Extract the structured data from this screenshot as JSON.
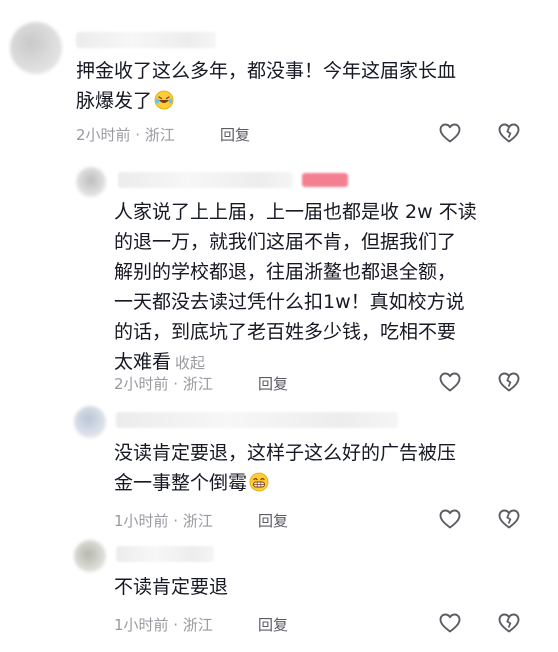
{
  "comments": [
    {
      "text_lines": [
        "押金收了这么多年，都没事！今年这届家长血",
        "脉爆发了"
      ],
      "emoji": "laughing-tears-emoji",
      "time_location": "2小时前 · 浙江",
      "reply_label": "回复"
    },
    {
      "text_lines": [
        "人家说了上上届，上一届也都是收 2w 不读",
        "的退一万，就我们这届不肯，但据我们了",
        "解别的学校都退，往届浙鳌也都退全额，",
        "一天都没去读过凭什么扣1w！真如校方说",
        "的话，到底坑了老百姓多少钱，吃相不要",
        "太难看"
      ],
      "fold_label": "收起",
      "time_location": "2小时前 · 浙江",
      "reply_label": "回复"
    },
    {
      "text_lines": [
        "没读肯定要退，这样子这么好的广告被压",
        "金一事整个倒霉"
      ],
      "emoji": "grinning-emoji",
      "time_location": "1小时前 · 浙江",
      "reply_label": "回复"
    },
    {
      "text_lines": [
        "不读肯定要退"
      ],
      "time_location": "1小时前 · 浙江",
      "reply_label": "回复"
    }
  ],
  "icons": {
    "like": "heart-outline-icon",
    "dislike": "broken-heart-icon"
  },
  "colors": {
    "text": "#161823",
    "meta": "#9a9ba1",
    "badge": "#f26a7e"
  }
}
